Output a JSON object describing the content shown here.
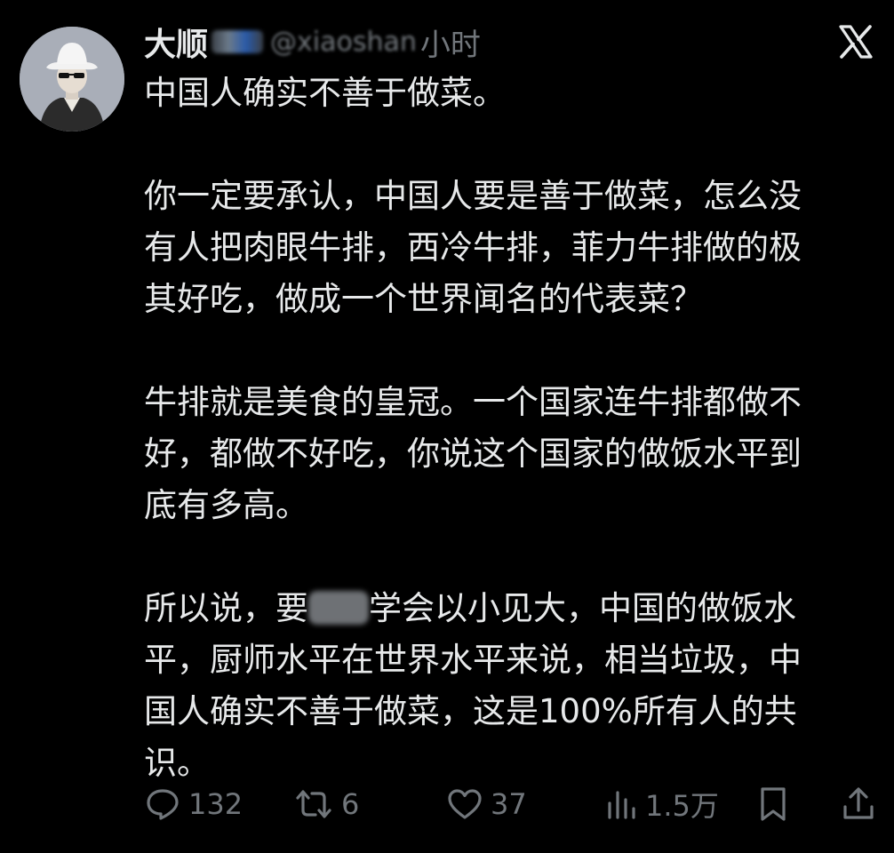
{
  "post": {
    "author": {
      "name": "大顺",
      "handle": "@xiaoshan",
      "avatar_icon": "avatar-bucket-hat"
    },
    "time": "小时",
    "platform_icon": "x-logo-icon",
    "paragraphs": [
      {
        "text": "中国人确实不善于做菜。"
      },
      {
        "text": "你一定要承认，中国人要是善于做菜，怎么没\n有人把肉眼牛排，西冷牛排，菲力牛排做的极\n其好吃，做成一个世界闻名的代表菜？"
      },
      {
        "text": "牛排就是美食的皇冠。一个国家连牛排都做不\n好，都做不好吃，你说这个国家的做饭水平到\n底有多高。"
      },
      {
        "before": "所以说，要",
        "after": "学会以小见大，中国的做饭水\n平，厨师水平在世界水平来说，相当垃圾，中\n国人确实不善于做菜，这是100%所有人的共\n识。"
      }
    ],
    "actions": {
      "replies": "132",
      "reposts": "6",
      "likes": "37",
      "views": "1.5万"
    }
  },
  "colors": {
    "background": "#000000",
    "text": "#e7e9ea",
    "muted": "#71767b"
  }
}
